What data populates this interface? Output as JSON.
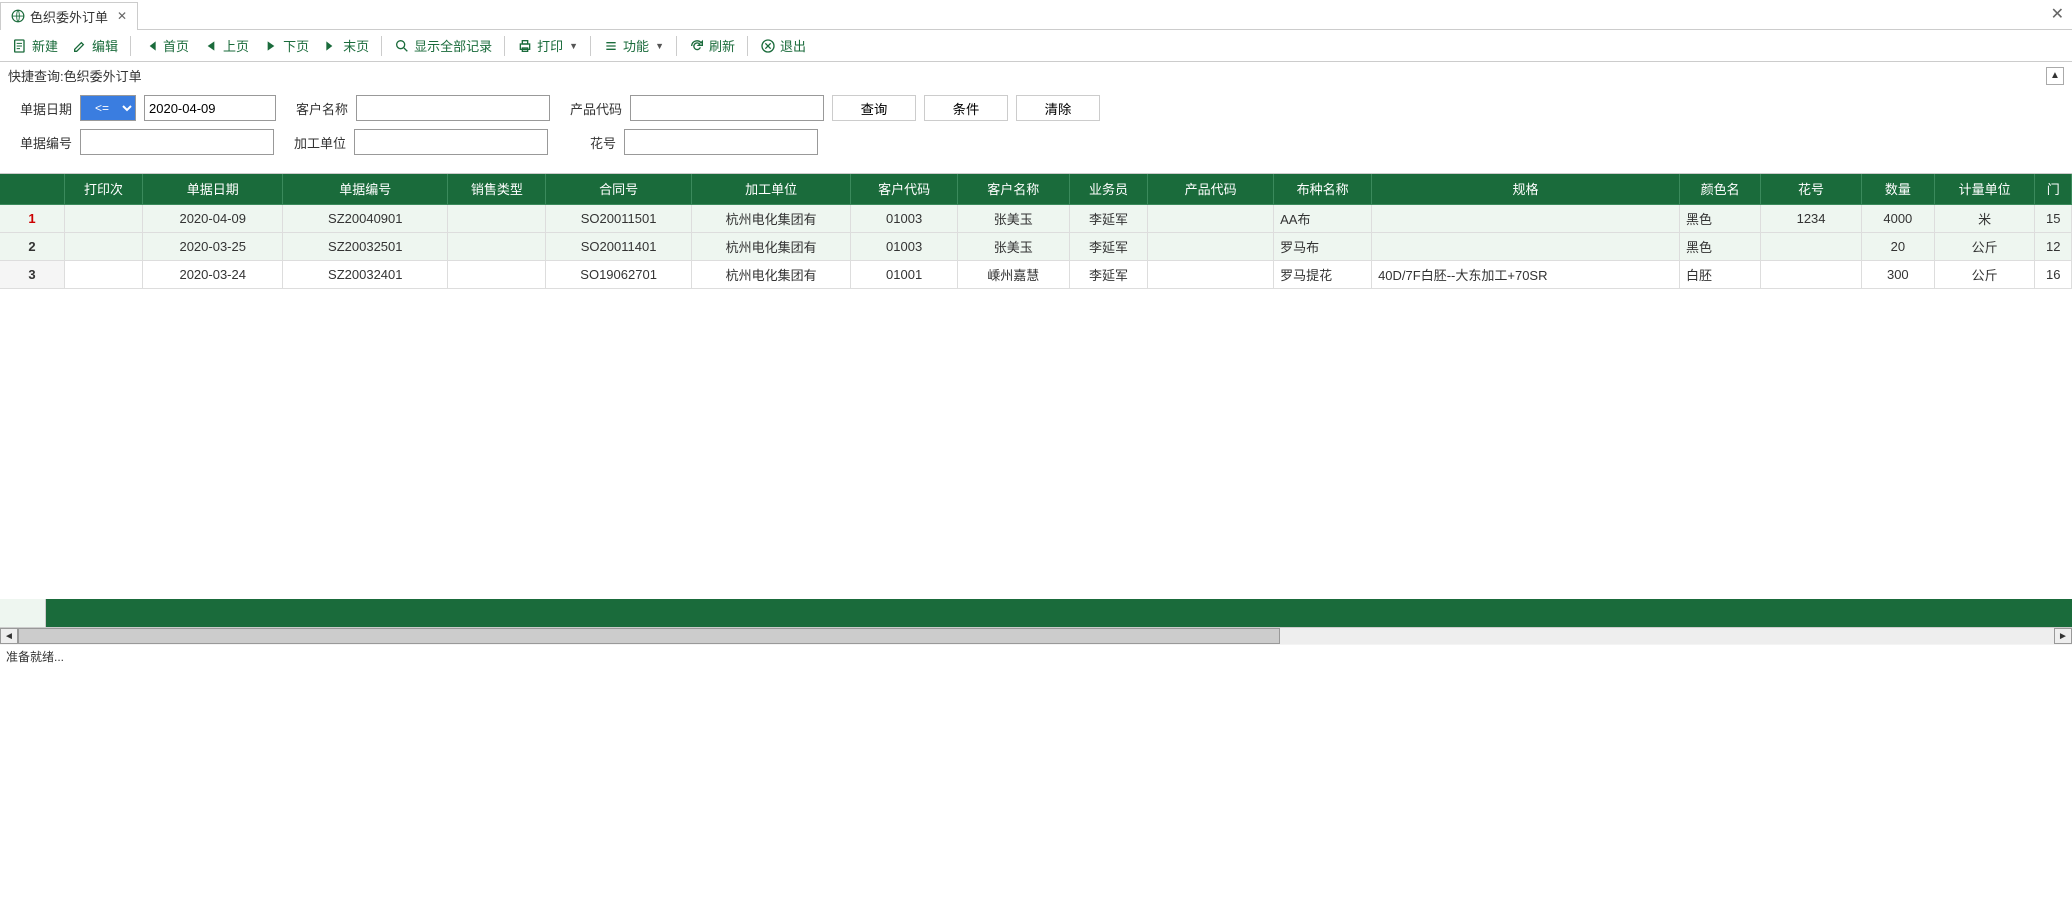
{
  "tab": {
    "title": "色织委外订单"
  },
  "toolbar": {
    "new": "新建",
    "edit": "编辑",
    "first": "首页",
    "prev": "上页",
    "next": "下页",
    "last": "末页",
    "showall": "显示全部记录",
    "print": "打印",
    "func": "功能",
    "refresh": "刷新",
    "exit": "退出"
  },
  "query": {
    "title": "快捷查询:色织委外订单",
    "labels": {
      "date": "单据日期",
      "cust": "客户名称",
      "prod": "产品代码",
      "docno": "单据编号",
      "proc": "加工单位",
      "pattern": "花号"
    },
    "op": "<=",
    "date": "2020-04-09",
    "btn_query": "查询",
    "btn_cond": "条件",
    "btn_clear": "清除"
  },
  "grid": {
    "cols": [
      "",
      "打印次",
      "单据日期",
      "单据编号",
      "销售类型",
      "合同号",
      "加工单位",
      "客户代码",
      "客户名称",
      "业务员",
      "产品代码",
      "布种名称",
      "规格",
      "颜色名",
      "花号",
      "数量",
      "计量单位",
      "门"
    ],
    "widths": [
      46,
      56,
      100,
      118,
      70,
      104,
      114,
      76,
      80,
      56,
      90,
      70,
      220,
      58,
      72,
      52,
      72,
      26
    ],
    "rows": [
      {
        "n": "1",
        "print": "",
        "date": "2020-04-09",
        "doc": "SZ20040901",
        "stype": "",
        "contract": "SO20011501",
        "proc": "杭州电化集团有",
        "ccode": "01003",
        "cname": "张美玉",
        "sales": "李延军",
        "pcode": "",
        "cloth": "AA布",
        "spec": "",
        "color": "黑色",
        "pattern": "1234",
        "qty": "4000",
        "unit": "米",
        "gate": "15"
      },
      {
        "n": "2",
        "print": "",
        "date": "2020-03-25",
        "doc": "SZ20032501",
        "stype": "",
        "contract": "SO20011401",
        "proc": "杭州电化集团有",
        "ccode": "01003",
        "cname": "张美玉",
        "sales": "李延军",
        "pcode": "",
        "cloth": "罗马布",
        "spec": "",
        "color": "黑色",
        "pattern": "",
        "qty": "20",
        "unit": "公斤",
        "gate": "12"
      },
      {
        "n": "3",
        "print": "",
        "date": "2020-03-24",
        "doc": "SZ20032401",
        "stype": "",
        "contract": "SO19062701",
        "proc": "杭州电化集团有",
        "ccode": "01001",
        "cname": "嵊州嘉慧",
        "sales": "李延军",
        "pcode": "",
        "cloth": "罗马提花",
        "spec": "40D/7F白胚--大东加工+70SR",
        "color": "白胚",
        "pattern": "",
        "qty": "300",
        "unit": "公斤",
        "gate": "16"
      }
    ]
  },
  "status": "准备就绪..."
}
